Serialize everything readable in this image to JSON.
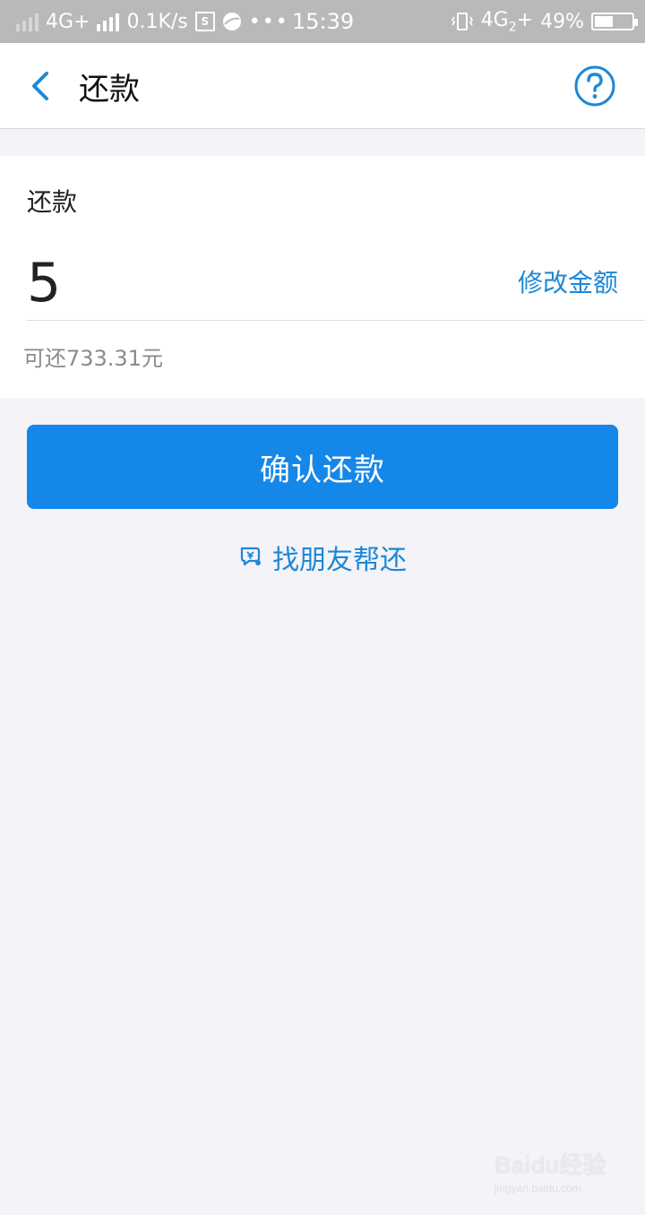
{
  "status_bar": {
    "network_left": "4G+",
    "speed": "0.1K/s",
    "s_badge": "S",
    "more": "•••",
    "time": "15:39",
    "network_right": "4G",
    "sim_index": "2",
    "battery": "49%"
  },
  "header": {
    "back_icon": "chevron-left-icon",
    "title": "还款",
    "help_icon": "question-circle-icon"
  },
  "form": {
    "label": "还款",
    "amount": "5",
    "modify_label": "修改金额",
    "available_text": "可还733.31元"
  },
  "actions": {
    "confirm_label": "确认还款",
    "friend_help_label": "找朋友帮还",
    "friend_icon": "yuan-chat-icon"
  },
  "watermark": {
    "logo": "Baidu经验",
    "url": "jingyan.baidu.com"
  },
  "colors": {
    "accent": "#1587e8",
    "link": "#1d88d6",
    "background": "#f4f3f8",
    "status_bar": "#b9b9b9"
  }
}
